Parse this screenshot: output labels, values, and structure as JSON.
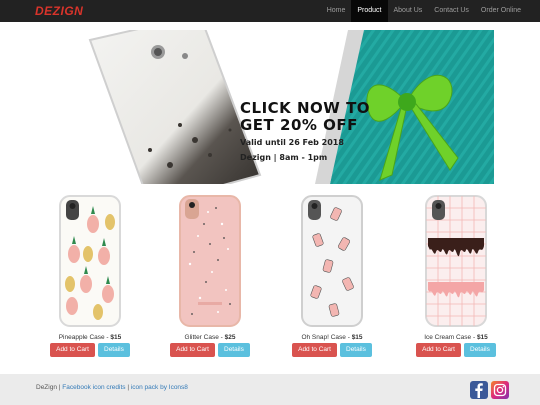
{
  "brand": "DEZIGN",
  "nav": [
    {
      "label": "Home",
      "active": false
    },
    {
      "label": "Product",
      "active": true
    },
    {
      "label": "About Us",
      "active": false
    },
    {
      "label": "Contact Us",
      "active": false
    },
    {
      "label": "Order Online",
      "active": false
    }
  ],
  "banner": {
    "headline_1": "CLICK NOW TO",
    "headline_2": "GET 20% OFF",
    "valid": "Valid until 26 Feb 2018",
    "hours": "Dezign | 8am - 1pm"
  },
  "products": [
    {
      "name": "Pineapple Case",
      "price": "$15",
      "cart": "Add to Cart",
      "details": "Details",
      "design": "pineapple"
    },
    {
      "name": "Glitter Case",
      "price": "$25",
      "cart": "Add to Cart",
      "details": "Details",
      "design": "glitter"
    },
    {
      "name": "Oh Snap! Case",
      "price": "$15",
      "cart": "Add to Cart",
      "details": "Details",
      "design": "bottles"
    },
    {
      "name": "Ice Cream Case",
      "price": "$15",
      "cart": "Add to Cart",
      "details": "Details",
      "design": "drip"
    }
  ],
  "footer": {
    "brand": "DeZign",
    "sep": " | ",
    "link1": "Facebook icon credits",
    "link2": "icon pack by Icons8",
    "icons": [
      "facebook-icon",
      "instagram-icon"
    ]
  },
  "colors": {
    "brand": "#d9342b",
    "navbar": "#222222",
    "teal": "#1b9a94",
    "cart": "#d9534f",
    "details": "#5bc0de"
  }
}
